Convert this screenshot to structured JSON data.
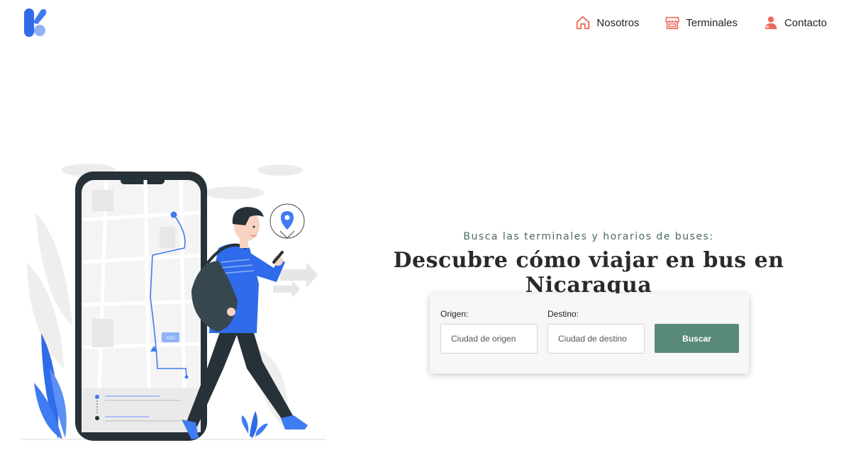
{
  "header": {
    "nav": [
      {
        "label": "Nosotros",
        "icon": "home-icon"
      },
      {
        "label": "Terminales",
        "icon": "store-icon"
      },
      {
        "label": "Contacto",
        "icon": "user-icon"
      }
    ]
  },
  "illustration": {
    "chat_bubble": "YOU"
  },
  "hero": {
    "subtitle": "Busca las terminales y horarios de buses:",
    "title": "Descubre cómo viajar en bus en Nicaragua"
  },
  "search": {
    "origin_label": "Origen:",
    "origin_placeholder": "Ciudad de origen",
    "destination_label": "Destino:",
    "destination_placeholder": "Ciudad de destino",
    "button_label": "Buscar"
  },
  "colors": {
    "brand_blue": "#2f6bea",
    "nav_icon_coral": "#ee6a5a",
    "button_green": "#58897a",
    "subtitle_green": "#4a6a5e"
  }
}
